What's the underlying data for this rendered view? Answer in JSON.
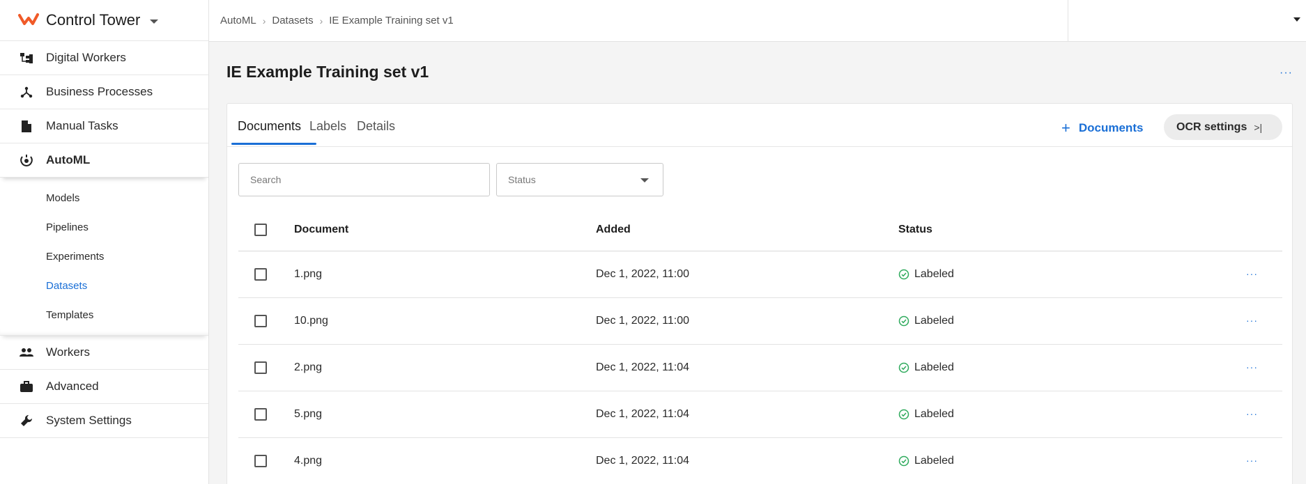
{
  "app": {
    "title": "Control Tower"
  },
  "sidebar": {
    "items": [
      {
        "label": "Digital Workers",
        "icon": "org-chart-icon"
      },
      {
        "label": "Business Processes",
        "icon": "process-icon"
      },
      {
        "label": "Manual Tasks",
        "icon": "document-icon"
      },
      {
        "label": "AutoML",
        "icon": "automl-icon"
      },
      {
        "label": "Workers",
        "icon": "people-icon"
      },
      {
        "label": "Advanced",
        "icon": "briefcase-icon"
      },
      {
        "label": "System Settings",
        "icon": "wrench-icon"
      }
    ],
    "subitems": [
      "Models",
      "Pipelines",
      "Experiments",
      "Datasets",
      "Templates"
    ],
    "selected_subitem": "Datasets"
  },
  "breadcrumb": [
    "AutoML",
    "Datasets",
    "IE Example Training set v1"
  ],
  "page": {
    "title": "IE Example Training set v1"
  },
  "tabs": [
    "Documents",
    "Labels",
    "Details"
  ],
  "actions": {
    "add_documents": "Documents",
    "ocr_settings": "OCR settings"
  },
  "filters": {
    "search_placeholder": "Search",
    "status_placeholder": "Status"
  },
  "table": {
    "headers": [
      "Document",
      "Added",
      "Status"
    ],
    "rows": [
      {
        "document": "1.png",
        "added": "Dec 1, 2022, 11:00",
        "status": "Labeled"
      },
      {
        "document": "10.png",
        "added": "Dec 1, 2022, 11:00",
        "status": "Labeled"
      },
      {
        "document": "2.png",
        "added": "Dec 1, 2022, 11:04",
        "status": "Labeled"
      },
      {
        "document": "5.png",
        "added": "Dec 1, 2022, 11:04",
        "status": "Labeled"
      },
      {
        "document": "4.png",
        "added": "Dec 1, 2022, 11:04",
        "status": "Labeled"
      }
    ]
  },
  "colors": {
    "accent": "#1a6fd6",
    "brand": "#f05a28",
    "success": "#2eaa5c"
  }
}
